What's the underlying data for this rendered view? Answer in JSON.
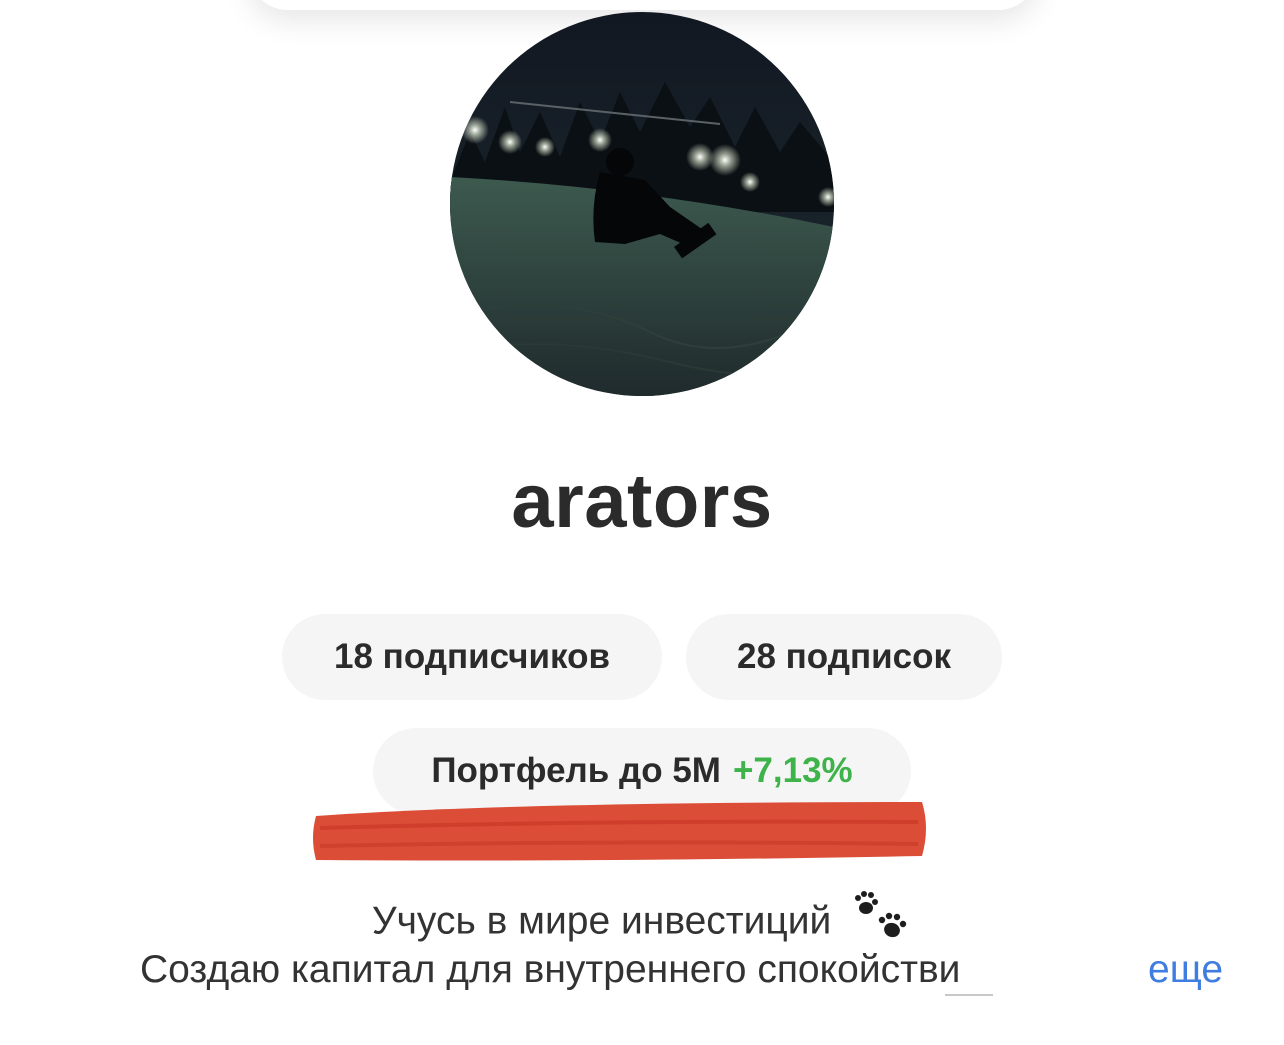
{
  "profile": {
    "username": "arators",
    "avatar": "avatar-photo-night-snowboarder"
  },
  "stats": {
    "followers_label": "18 подписчиков",
    "following_label": "28 подписок"
  },
  "portfolio": {
    "label": "Портфель до 5M",
    "change": "+7,13%",
    "change_color": "#3db34a"
  },
  "bio": {
    "line1": "Учусь в мире инвестиций",
    "line1_emoji": "paw-prints-icon",
    "line2": "Создаю капитал для внутреннего спокойстви",
    "more_label": "еще",
    "more_color": "#3f7de0"
  },
  "redaction": {
    "color": "#d9432c"
  }
}
